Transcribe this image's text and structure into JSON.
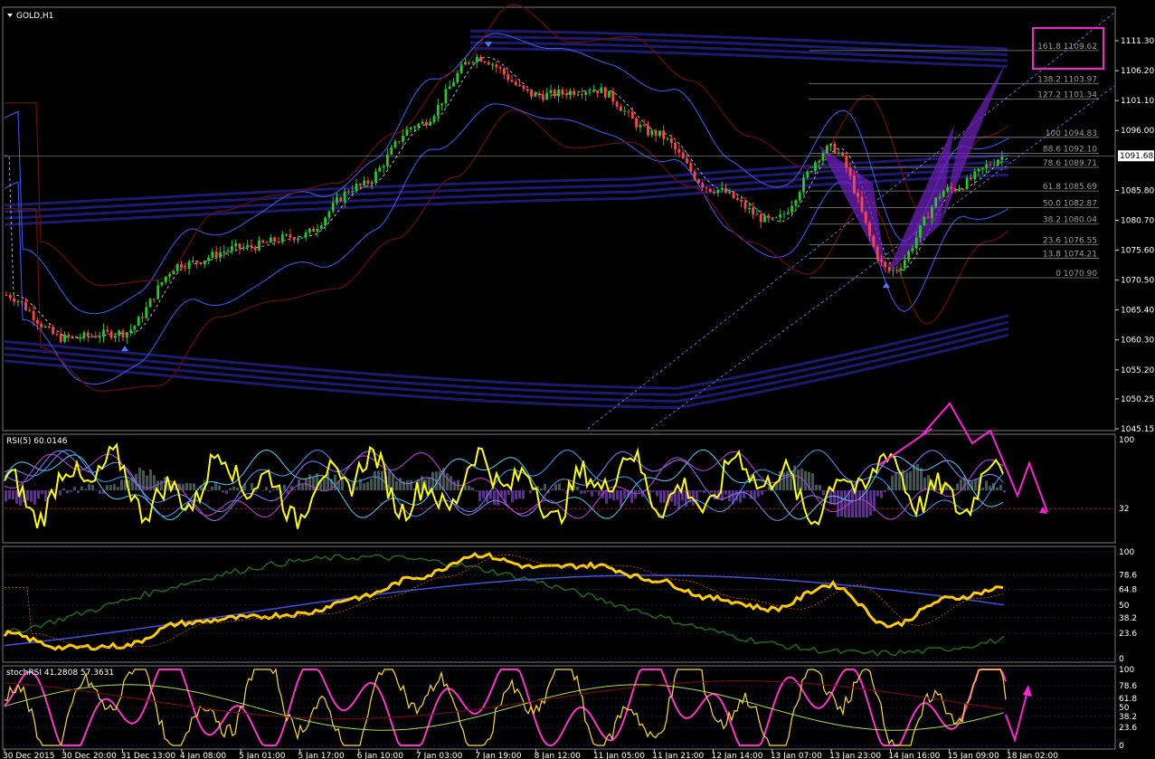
{
  "window": {
    "symbol_label": "GOLD,H1",
    "rsi_label": "RSI(5) 60.0146",
    "stoch_label": "stochRSI 41.2808 57.3631"
  },
  "colors": {
    "background": "#000000",
    "bull_candle": "#22cc22",
    "bear_candle": "#ff4444",
    "ma_bands": "#1a1a6e",
    "bollinger": "#3d5cff",
    "envelope": "#6b0d0d",
    "pattern": "#6a1fb5",
    "annotation": "#ff20d8",
    "rsi_line": "#ffff00",
    "stoch_line": "#ff33cc",
    "osc_line": "#ffcc00",
    "osc_green": "#1e6b1e",
    "grid": "#333333"
  },
  "chart_data": [
    {
      "type": "candlestick",
      "title": "GOLD,H1",
      "current_price": "1091.68",
      "ylim": [
        1045.15,
        1111.3
      ],
      "y_ticks": [
        "1111.30",
        "1106.20",
        "1101.10",
        "1096.00",
        "1091.68",
        "1085.80",
        "1080.70",
        "1075.60",
        "1070.50",
        "1065.40",
        "1060.30",
        "1055.20",
        "1050.25",
        "1045.15"
      ],
      "x_ticks": [
        "30 Dec 2015",
        "30 Dec 20:00",
        "31 Dec 13:00",
        "4 Jan 08:00",
        "5 Jan 01:00",
        "5 Jan 17:00",
        "6 Jan 10:00",
        "7 Jan 03:00",
        "7 Jan 19:00",
        "8 Jan 12:00",
        "11 Jan 05:00",
        "11 Jan 21:00",
        "12 Jan 14:00",
        "13 Jan 07:00",
        "13 Jan 23:00",
        "14 Jan 16:00",
        "15 Jan 09:00",
        "18 Jan 02:00"
      ],
      "close_path": [
        {
          "x": "30 Dec 2015",
          "y": 1068.0
        },
        {
          "x": "30 Dec 20:00",
          "y": 1060.6
        },
        {
          "x": "31 Dec 13:00",
          "y": 1061.5
        },
        {
          "x": "4 Jan 08:00",
          "y": 1073.2
        },
        {
          "x": "5 Jan 01:00",
          "y": 1076.0
        },
        {
          "x": "5 Jan 17:00",
          "y": 1078.0
        },
        {
          "x": "6 Jan 10:00",
          "y": 1086.5
        },
        {
          "x": "7 Jan 03:00",
          "y": 1097.0
        },
        {
          "x": "7 Jan 19:00",
          "y": 1108.5
        },
        {
          "x": "8 Jan 12:00",
          "y": 1102.0
        },
        {
          "x": "11 Jan 05:00",
          "y": 1103.0
        },
        {
          "x": "11 Jan 21:00",
          "y": 1095.5
        },
        {
          "x": "12 Jan 14:00",
          "y": 1086.0
        },
        {
          "x": "13 Jan 07:00",
          "y": 1080.5
        },
        {
          "x": "13 Jan 23:00",
          "y": 1093.0
        },
        {
          "x": "14 Jan 16:00",
          "y": 1072.0
        },
        {
          "x": "15 Jan 09:00",
          "y": 1086.0
        },
        {
          "x": "18 Jan 02:00",
          "y": 1091.68
        }
      ],
      "fibonacci": [
        {
          "label": "161.8 1109.62",
          "value": 1109.62
        },
        {
          "label": "138.2 1103.97",
          "value": 1103.97
        },
        {
          "label": "127.2 1101.34",
          "value": 1101.34
        },
        {
          "label": "100 1094.83",
          "value": 1094.83
        },
        {
          "label": "88.6 1092.10",
          "value": 1092.1
        },
        {
          "label": "78.6 1089.71",
          "value": 1089.71
        },
        {
          "label": "61.8 1085.69",
          "value": 1085.69
        },
        {
          "label": "50.0 1082.87",
          "value": 1082.87
        },
        {
          "label": "38.2 1080.04",
          "value": 1080.04
        },
        {
          "label": "23.6 1076.55",
          "value": 1076.55
        },
        {
          "label": "13.8 1074.21",
          "value": 1074.21
        },
        {
          "label": "0 1070.90",
          "value": 1070.9
        }
      ]
    },
    {
      "type": "line",
      "title": "RSI(5) 60.0146",
      "ylim": [
        0,
        100
      ],
      "y_ticks": [
        "100",
        "32"
      ],
      "level": 32,
      "current_value": 60.0146
    },
    {
      "type": "line",
      "title": "",
      "ylim": [
        0,
        100
      ],
      "y_ticks": [
        "100",
        "78.6",
        "64.8",
        "50",
        "38.2",
        "23.6",
        "0"
      ]
    },
    {
      "type": "line",
      "title": "stochRSI 41.2808 57.3631",
      "ylim": [
        0,
        100
      ],
      "y_ticks": [
        "100",
        "78.6",
        "61.8",
        "50",
        "38.2",
        "23.6",
        "0"
      ],
      "values": [
        41.2808,
        57.3631
      ]
    }
  ]
}
